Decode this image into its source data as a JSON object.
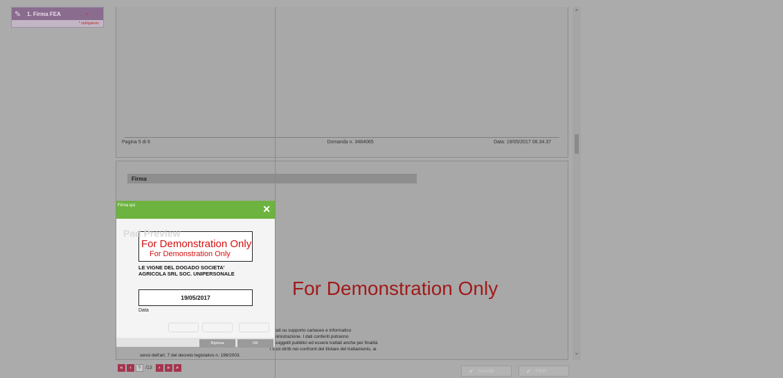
{
  "sidebar": {
    "step_label": "1. Firma FEA",
    "required_note": "* obbligatorio"
  },
  "document": {
    "footer": {
      "page": "Pagina 5 di  6",
      "application": "Domanda n. 3484065",
      "date": "Data:  19/05/2017 08.34.37"
    },
    "section_title": "Firma",
    "watermark": "For Demonstration Only",
    "legal_lines": [
      "Ai sensi del decreto legislativo n. 196/2003 i dati forniti verranno trattati su supporto cartaceo e informatico",
      "esclusivamente nell'ambito e per i fini istituzionali della pubblica amministrazione. I dati conferiti potranno",
      "tri soggetti pubblici ed essere trattati anche per finalità",
      "i suoi diritti nei confronti del titolare del trattamento, ai",
      "sensi dell'art. 7 del decreto legislativo n. 196/2003."
    ]
  },
  "popup": {
    "title": "Firma qui",
    "close_glyph": "✕",
    "pad_preview": "Pad Preview",
    "watermark_large": "For Demonstration Only",
    "watermark_small": "For Demonstration Only",
    "company_line1": "LE VIGNE DEL DOGADO SOCIETA'",
    "company_line2": "AGRICOLA SRL SOC. UNIPERSONALE",
    "date_value": "19/05/2017",
    "date_label": "Data",
    "retry_label": "Riprova",
    "ok_label": "OK"
  },
  "toolbar": {
    "current_page": "5",
    "total_pages": "/13",
    "annulla": "Annulla",
    "fine": "FINE"
  },
  "icons": [
    "pen-icon",
    "close-icon",
    "first-page-icon",
    "prev-page-icon",
    "next-page-icon",
    "last-page-icon",
    "zoom-icon",
    "check-icon",
    "scroll-up-icon",
    "scroll-down-icon"
  ]
}
